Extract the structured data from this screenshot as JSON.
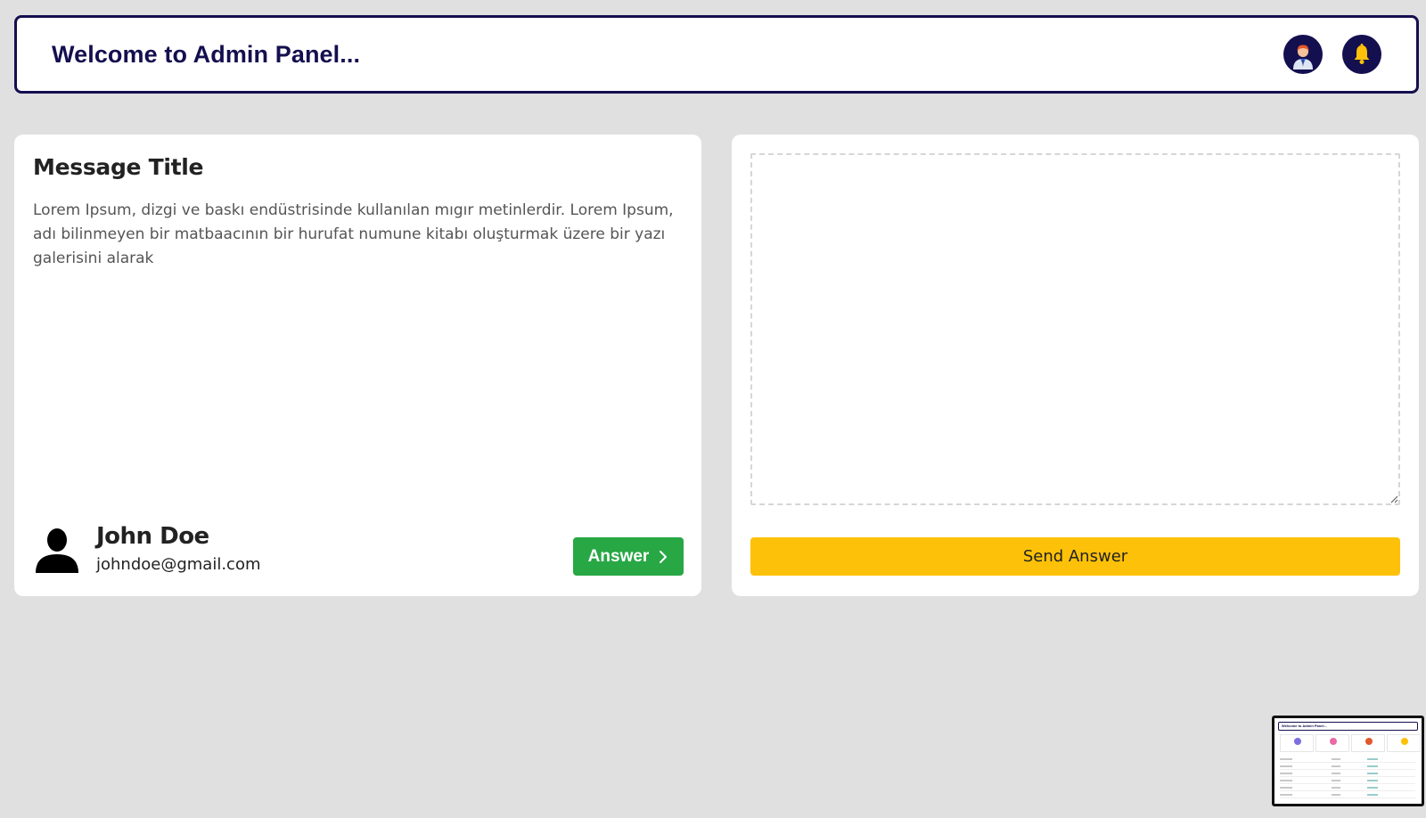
{
  "header": {
    "title": "Welcome to Admin Panel...",
    "profile_icon": "user-avatar-icon",
    "notification_icon": "bell-icon"
  },
  "message": {
    "title": "Message Title",
    "body": "Lorem Ipsum, dizgi ve baskı endüstrisinde kullanılan mıgır metinlerdir. Lorem Ipsum, adı bilinmeyen bir matbaacının bir hurufat numune kitabı oluşturmak üzere bir yazı galerisini alarak",
    "sender": {
      "name": "John Doe",
      "email": "johndoe@gmail.com",
      "icon": "person-silhouette-icon"
    },
    "answer_button": "Answer"
  },
  "reply": {
    "textarea_value": "",
    "send_button": "Send Answer"
  },
  "colors": {
    "brand": "#140f4f",
    "answer": "#28a745",
    "send": "#fdc10a",
    "background": "#e0e0e0"
  }
}
